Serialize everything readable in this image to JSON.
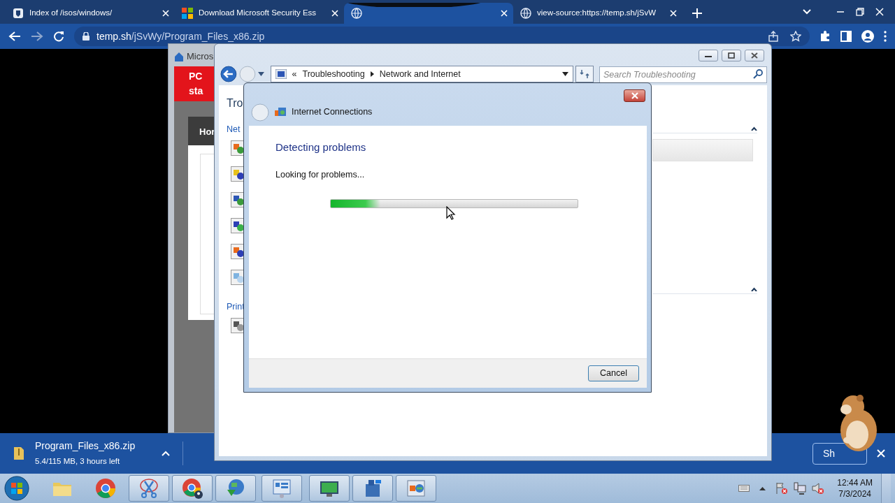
{
  "browser": {
    "tabs": [
      {
        "title": "Index of /isos/windows/",
        "kind": "site",
        "selected": false
      },
      {
        "title": "Download Microsoft Security Ess",
        "kind": "tiles",
        "selected": false
      },
      {
        "kind": "globe",
        "selected": true
      },
      {
        "title": "view-source:https://temp.sh/jSvW",
        "kind": "globe",
        "selected": false
      }
    ],
    "address": {
      "domain": "temp.sh",
      "path": "/jSvWy/Program_Files_x86.zip"
    }
  },
  "background_window": {
    "title": "Micros",
    "banner": "PC sta",
    "nav_button": "Hor"
  },
  "explorer_window": {
    "overflow": "«",
    "breadcrumbs": [
      "Troubleshooting",
      "Network and Internet"
    ],
    "search": {
      "placeholder": "Search Troubleshooting"
    },
    "heading": "Tro",
    "sections": [
      {
        "label": "Net",
        "items": [
          {
            "kind": "net"
          },
          {
            "kind": "printer-net"
          },
          {
            "kind": "globe"
          },
          {
            "kind": "computer"
          },
          {
            "kind": "share"
          },
          {
            "kind": "folder"
          }
        ]
      },
      {
        "label": "Print",
        "items": [
          {
            "kind": "printer"
          }
        ]
      }
    ]
  },
  "dialog": {
    "title": "Internet Connections",
    "heading": "Detecting problems",
    "status": "Looking for problems...",
    "progress": {
      "level": 0.2
    },
    "buttons": [
      "Cancel"
    ]
  },
  "download_bar": {
    "file": "Program_Files_x86.zip",
    "detail": "5.4/115 MB, 3 hours left",
    "show_all_button": "Sh"
  },
  "taskbar": {
    "items": [
      {
        "kind": "folder",
        "running": false
      },
      {
        "kind": "chrome",
        "running": false
      },
      {
        "kind": "scissors",
        "running": true
      },
      {
        "kind": "chrome-profile",
        "running": true
      },
      {
        "kind": "globe-arrow",
        "running": true
      },
      {
        "kind": "panel",
        "running": true
      },
      {
        "kind": "monitor",
        "running": true
      },
      {
        "kind": "building",
        "running": true
      },
      {
        "kind": "troubleshoot",
        "running": true
      }
    ],
    "clock": {
      "time": "12:44 AM",
      "date": "7/3/2024"
    }
  }
}
